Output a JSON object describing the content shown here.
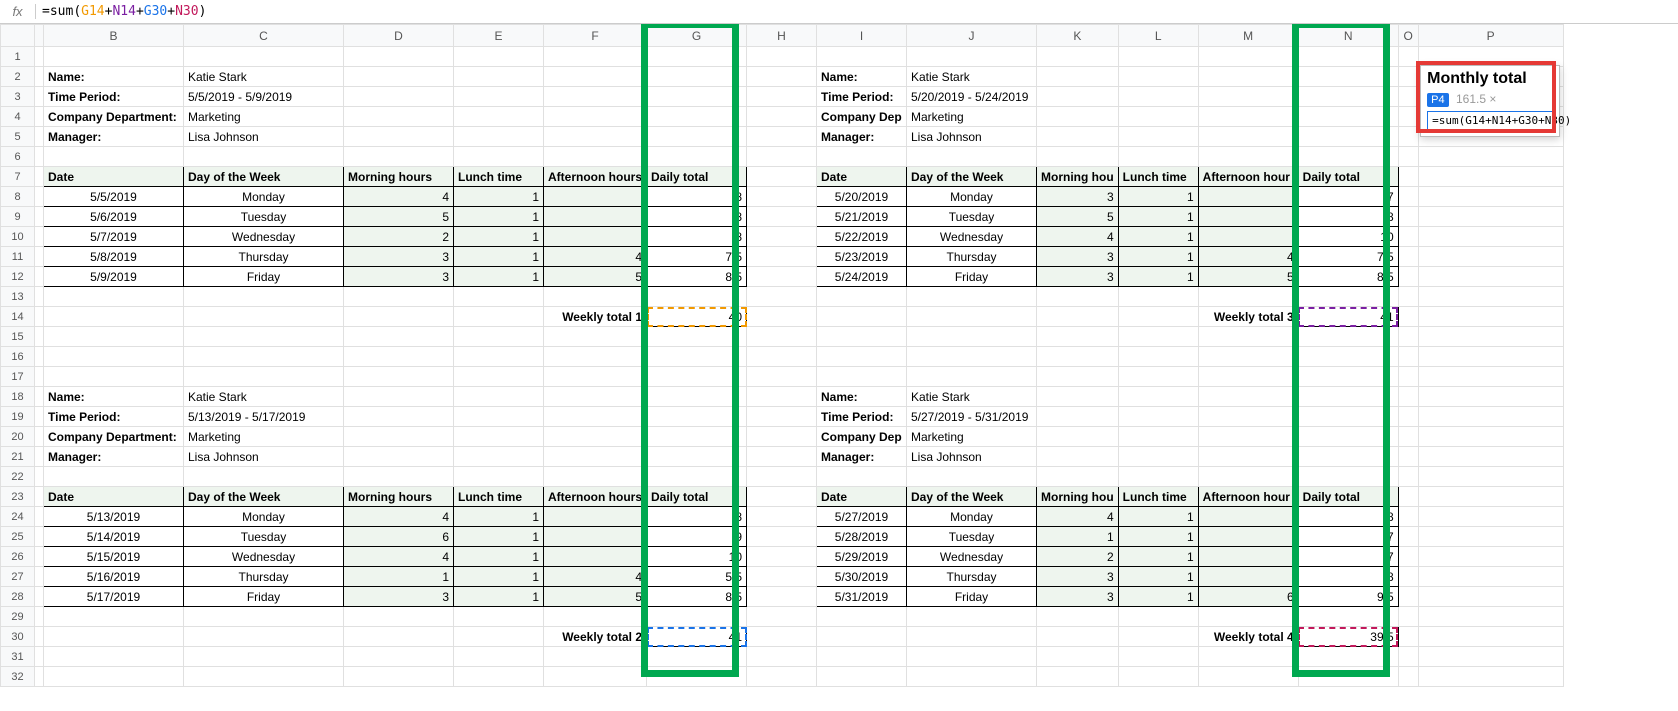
{
  "formula_bar": {
    "eq": "=",
    "func": "sum",
    "lpar": "(",
    "r1": "G14",
    "p1": "+",
    "r2": "N14",
    "p2": "+",
    "r3": "G30",
    "p3": "+",
    "r4": "N30",
    "rpar": ")"
  },
  "columns": [
    "",
    "B",
    "C",
    "D",
    "E",
    "F",
    "G",
    "H",
    "I",
    "J",
    "K",
    "L",
    "M",
    "N",
    "O",
    "P"
  ],
  "labels": {
    "name": "Name:",
    "period": "Time Period:",
    "dept_long": "Company Department:",
    "dept_short": "Company Dep",
    "mgr": "Manager:",
    "date": "Date",
    "dow": "Day of the Week",
    "morn": "Morning hours",
    "lunch": "Lunch time",
    "aftn": "Afternoon hours",
    "aftn_short": "Afternoon hour",
    "morn_short": "Morning hou",
    "daily": "Daily total",
    "wk": [
      "Weekly total 1",
      "Weekly total 2",
      "Weekly total 3",
      "Weekly total 4"
    ]
  },
  "person": {
    "name": "Katie Stark",
    "dept": "Marketing",
    "mgr": "Lisa Johnson"
  },
  "blocks": [
    {
      "period": "5/5/2019 - 5/9/2019",
      "total": 40,
      "rows": [
        [
          "5/5/2019",
          "Monday",
          4,
          1,
          "",
          8
        ],
        [
          "5/6/2019",
          "Tuesday",
          5,
          1,
          "",
          8
        ],
        [
          "5/7/2019",
          "Wednesday",
          2,
          1,
          "",
          8
        ],
        [
          "5/8/2019",
          "Thursday",
          3,
          1,
          4,
          7.5
        ],
        [
          "5/9/2019",
          "Friday",
          3,
          1,
          5,
          8.5
        ]
      ]
    },
    {
      "period": "5/20/2019 - 5/24/2019",
      "total": 41,
      "rows": [
        [
          "5/20/2019",
          "Monday",
          3,
          1,
          "",
          7
        ],
        [
          "5/21/2019",
          "Tuesday",
          5,
          1,
          "",
          8
        ],
        [
          "5/22/2019",
          "Wednesday",
          4,
          1,
          "",
          10
        ],
        [
          "5/23/2019",
          "Thursday",
          3,
          1,
          4,
          7.5
        ],
        [
          "5/24/2019",
          "Friday",
          3,
          1,
          5,
          8.5
        ]
      ]
    },
    {
      "period": "5/13/2019 - 5/17/2019",
      "total": 41,
      "rows": [
        [
          "5/13/2019",
          "Monday",
          4,
          1,
          "",
          8
        ],
        [
          "5/14/2019",
          "Tuesday",
          6,
          1,
          "",
          9
        ],
        [
          "5/15/2019",
          "Wednesday",
          4,
          1,
          "",
          10
        ],
        [
          "5/16/2019",
          "Thursday",
          1,
          1,
          4,
          5.5
        ],
        [
          "5/17/2019",
          "Friday",
          3,
          1,
          5,
          8.5
        ]
      ]
    },
    {
      "period": "5/27/2019 - 5/31/2019",
      "total": 39.5,
      "rows": [
        [
          "5/27/2019",
          "Monday",
          4,
          1,
          "",
          8
        ],
        [
          "5/28/2019",
          "Tuesday",
          1,
          1,
          "",
          7
        ],
        [
          "5/29/2019",
          "Wednesday",
          2,
          1,
          "",
          7
        ],
        [
          "5/30/2019",
          "Thursday",
          3,
          1,
          "",
          8
        ],
        [
          "5/31/2019",
          "Friday",
          3,
          1,
          6,
          9.5
        ]
      ]
    }
  ],
  "monthly": {
    "title": "Monthly total",
    "cell": "P4",
    "val": "161.5 ×",
    "formula_prefix": "=sum(",
    "formula_suffix": ")"
  }
}
